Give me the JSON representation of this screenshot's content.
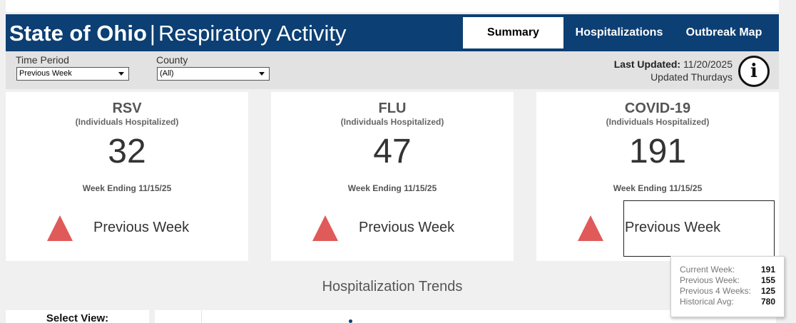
{
  "header": {
    "title_bold": "State of Ohio",
    "title_sep": "|",
    "title_rest": "Respiratory Activity",
    "tabs": [
      {
        "label": "Summary",
        "active": true
      },
      {
        "label": "Hospitalizations",
        "active": false
      },
      {
        "label": "Outbreak Map",
        "active": false
      }
    ],
    "bg_color": "#0c3f73"
  },
  "filters": {
    "time_period": {
      "label": "Time Period",
      "value": "Previous Week"
    },
    "county": {
      "label": "County",
      "value": "(All)"
    },
    "last_updated_label": "Last Updated:",
    "last_updated_value": "11/20/2025",
    "update_schedule": "Updated Thurdays",
    "info_icon": "info-icon"
  },
  "cards": [
    {
      "title": "RSV",
      "subtitle": "(Individuals Hospitalized)",
      "value": "32",
      "week_ending": "Week Ending 11/15/25",
      "comparison": "Previous Week",
      "trend_icon": "up-triangle-icon"
    },
    {
      "title": "FLU",
      "subtitle": "(Individuals Hospitalized)",
      "value": "47",
      "week_ending": "Week Ending 11/15/25",
      "comparison": "Previous Week",
      "trend_icon": "up-triangle-icon"
    },
    {
      "title": "COVID-19",
      "subtitle": "(Individuals Hospitalized)",
      "value": "191",
      "week_ending": "Week Ending 11/15/25",
      "comparison": "Previous Week",
      "trend_icon": "up-triangle-icon"
    }
  ],
  "trend_color": "#e05a5a",
  "tooltip": {
    "rows": [
      {
        "label": "Current Week:",
        "value": "191"
      },
      {
        "label": "Previous Week:",
        "value": "155"
      },
      {
        "label": "Previous 4 Weeks:",
        "value": "125"
      },
      {
        "label": "Historical Avg:",
        "value": "780"
      }
    ]
  },
  "trends": {
    "title": "Hospitalization Trends",
    "select_view_label": "Select View:"
  }
}
